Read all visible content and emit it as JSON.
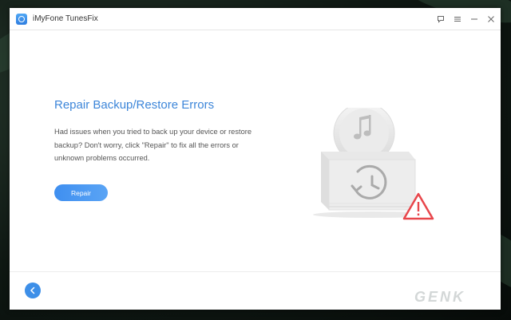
{
  "window": {
    "title": "iMyFone TunesFix",
    "controls": [
      "feedback-icon",
      "menu-icon",
      "minimize-icon",
      "close-icon"
    ]
  },
  "main": {
    "heading": "Repair Backup/Restore Errors",
    "description": "Had issues when you tried to back up your device or restore backup? Don't worry, click \"Repair\" to fix all the errors or unknown problems occurred.",
    "repair_label": "Repair"
  },
  "footer": {
    "back_icon": "chevron-left-icon"
  },
  "watermark": "GENK",
  "colors": {
    "accent": "#3d86d9",
    "button": "#4a98f2",
    "warning": "#e8464b"
  }
}
